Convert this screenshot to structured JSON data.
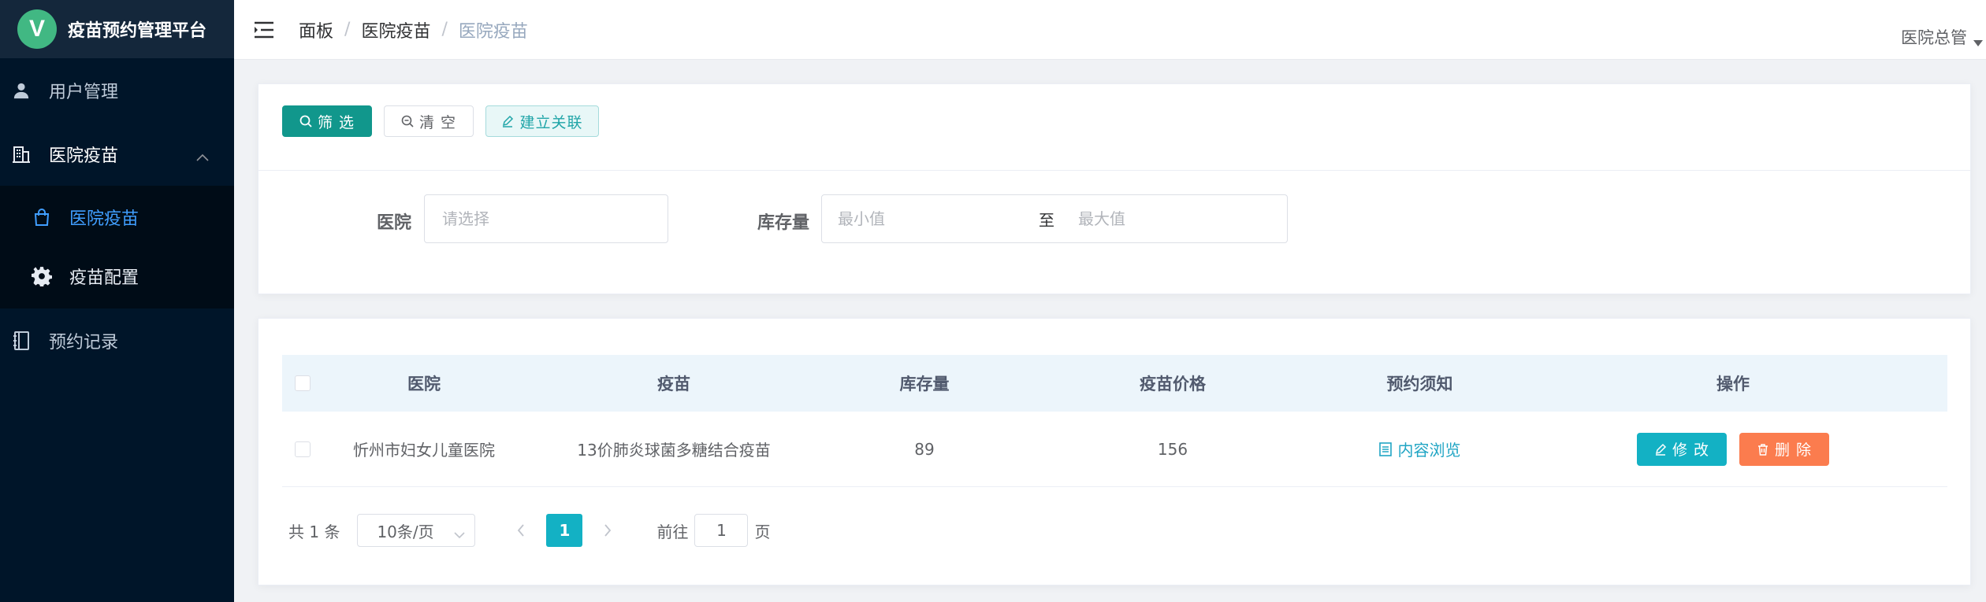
{
  "brand": {
    "logo_letter": "V",
    "title": "疫苗预约管理平台",
    "logo_color": "#41b883"
  },
  "sidebar": {
    "items": [
      {
        "label": "用户管理",
        "icon": "user-icon"
      },
      {
        "label": "医院疫苗",
        "icon": "building-icon",
        "expanded": true,
        "children": [
          {
            "label": "医院疫苗",
            "icon": "bag-icon",
            "active": true
          },
          {
            "label": "疫苗配置",
            "icon": "gear-icon"
          }
        ]
      },
      {
        "label": "预约记录",
        "icon": "notebook-icon"
      }
    ]
  },
  "header": {
    "breadcrumb": [
      "面板",
      "医院疫苗",
      "医院疫苗"
    ],
    "user": "医院总管"
  },
  "toolbar": {
    "filter_label": "筛 选",
    "clear_label": "清 空",
    "link_label": "建立关联"
  },
  "filters": {
    "hospital_label": "医院",
    "hospital_placeholder": "请选择",
    "stock_label": "库存量",
    "min_placeholder": "最小值",
    "to_label": "至",
    "max_placeholder": "最大值"
  },
  "table": {
    "columns": [
      "医院",
      "疫苗",
      "库存量",
      "疫苗价格",
      "预约须知",
      "操作"
    ],
    "rows": [
      {
        "hospital": "忻州市妇女儿童医院",
        "vaccine": "13价肺炎球菌多糖结合疫苗",
        "stock": "89",
        "price": "156",
        "notice": "内容浏览",
        "edit": "修 改",
        "delete": "删 除"
      }
    ]
  },
  "pagination": {
    "total": "共 1 条",
    "page_size": "10条/页",
    "current_page": "1",
    "goto_label": "前往",
    "goto_value": "1",
    "page_suffix": "页"
  },
  "colors": {
    "sidebar_bg": "#001529",
    "active_menu": "#409eff",
    "primary": "#11978c",
    "edit_button": "#13b1c4",
    "delete_button": "#fb7c4e"
  }
}
